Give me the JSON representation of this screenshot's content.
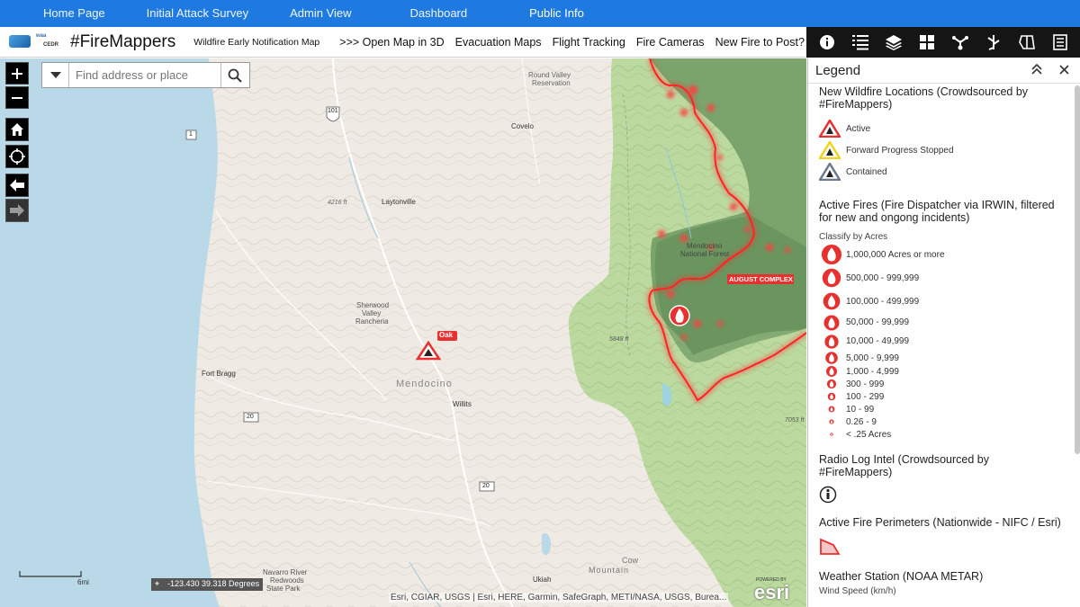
{
  "topnav": {
    "items": [
      {
        "label": "Home Page"
      },
      {
        "label": "Initial Attack Survey"
      },
      {
        "label": "Admin View"
      },
      {
        "label": "Dashboard"
      },
      {
        "label": "Public Info"
      }
    ]
  },
  "header": {
    "logo_top": "waa",
    "logo_bottom": "CEDR",
    "brand": "#FireMappers",
    "subtitle": "Wildfire Early Notification Map",
    "links": [
      {
        "label": ">>> Open Map in 3D"
      },
      {
        "label": "Evacuation Maps"
      },
      {
        "label": "Flight Tracking"
      },
      {
        "label": "Fire Cameras"
      },
      {
        "label": "New Fire to Post?"
      }
    ]
  },
  "toolbar": {
    "icons": [
      "info-icon",
      "list-icon",
      "layers-icon",
      "basemap-grid-icon",
      "share-icon",
      "routing-icon",
      "measure-icon",
      "menu-icon"
    ]
  },
  "search": {
    "placeholder": "Find address or place"
  },
  "map": {
    "labels": {
      "round_valley": "Round Valley",
      "reservation": "Reservation",
      "covelo": "Covelo",
      "laytonville": "Laytonville",
      "elev_4216": "4216 ft",
      "sherwood1": "Sherwood",
      "sherwood2": "Valley",
      "sherwood3": "Rancheria",
      "fort_bragg": "Fort Bragg",
      "mendocino_county": "Mendocino",
      "willits": "Willits",
      "mendocino_nf1": "Mendocino",
      "mendocino_nf2": "National Forest",
      "elev_5848": "5848 ft",
      "elev_7053": "7053 ft",
      "cow_mountain1": "Cow",
      "cow_mountain2": "Mountain",
      "ukiah": "Ukiah",
      "navarro1": "Navarro River",
      "navarro2": "Redwoods",
      "navarro3": "State Park",
      "august_complex": "AUGUST COMPLEX",
      "oak": "Oak",
      "route_101": "101",
      "route_1": "1",
      "route_20a": "20",
      "route_20b": "20"
    },
    "scale_label": "6mi",
    "coordinates": "-123.430 39.318 Degrees",
    "attribution": "Esri, CGIAR, USGS | Esri, HERE, Garmin, SafeGraph, METI/NASA, USGS, Burea...",
    "esri_powered": "POWERED BY",
    "esri_logo": "esri"
  },
  "legend": {
    "title": "Legend",
    "sections": {
      "crowd": {
        "title": "New Wildfire Locations (Crowdsourced by #FireMappers)",
        "items": [
          {
            "label": "Active",
            "color": "#e8312f"
          },
          {
            "label": "Forward Progress Stopped",
            "color": "#f2d21b"
          },
          {
            "label": "Contained",
            "color": "#6b7a8f"
          }
        ]
      },
      "active": {
        "title": "Active Fires (Fire Dispatcher via IRWIN, filtered for new and ongong incidents)",
        "subtitle": "Classify by Acres",
        "classes": [
          {
            "label": "1,000,000 Acres or more"
          },
          {
            "label": "500,000 - 999,999"
          },
          {
            "label": "100,000 - 499,999"
          },
          {
            "label": "50,000 - 99,999"
          },
          {
            "label": "10,000 - 49,999"
          },
          {
            "label": "5,000 - 9,999"
          },
          {
            "label": "1,000 - 4,999"
          },
          {
            "label": "300 - 999"
          },
          {
            "label": "100 - 299"
          },
          {
            "label": "10 - 99"
          },
          {
            "label": "0.26 - 9"
          },
          {
            "label": "< .25 Acres"
          }
        ]
      },
      "radio": {
        "title": "Radio Log Intel (Crowdsourced by #FireMappers)"
      },
      "perim": {
        "title": "Active Fire Perimeters (Nationwide - NIFC / Esri)"
      },
      "weather": {
        "title": "Weather Station (NOAA METAR)",
        "subtitle": "Wind Speed (km/h)"
      }
    }
  },
  "colors": {
    "nav_blue": "#1e7ae0",
    "toolbar_black": "#151515",
    "fire_red": "#e8312f",
    "forest_green": "#b9d99a"
  }
}
